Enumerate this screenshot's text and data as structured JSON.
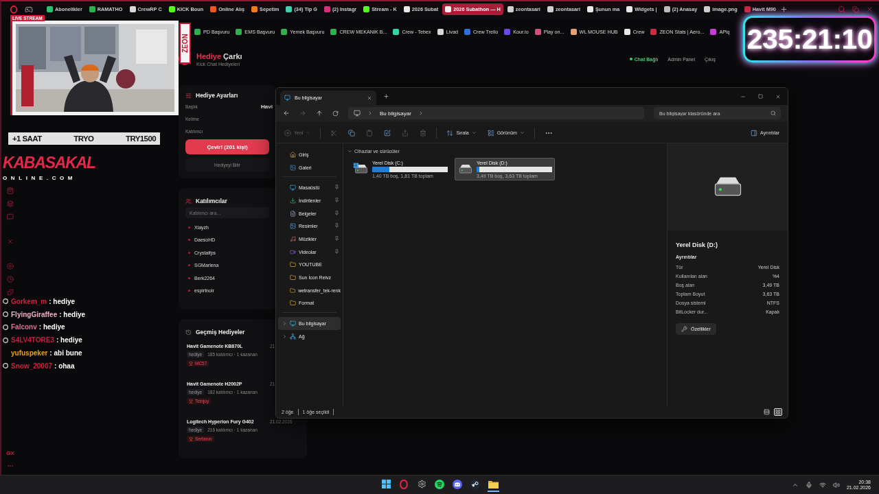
{
  "browser": {
    "tabs": [
      {
        "label": "Abonelikler",
        "color": "#2fbf71",
        "selected": false
      },
      {
        "label": "RAMATHO",
        "color": "#2fae4e",
        "selected": false
      },
      {
        "label": "CrewRP C",
        "color": "#d8d8d8",
        "selected": false
      },
      {
        "label": "KICK Boun",
        "color": "#53fc18",
        "selected": false
      },
      {
        "label": "Online Alış",
        "color": "#e8562a",
        "selected": false
      },
      {
        "label": "Sepetim",
        "color": "#f27a1a",
        "selected": false
      },
      {
        "label": "(34) Tip G",
        "color": "#3fd0b0",
        "selected": false
      },
      {
        "label": "(2) Instagr",
        "color": "#d6307a",
        "selected": false
      },
      {
        "label": "Stream - K",
        "color": "#53fc18",
        "selected": false
      },
      {
        "label": "2026 Subat",
        "color": "#e8e8e8",
        "selected": false
      },
      {
        "label": "2026 Subathon — H",
        "color": "#f0f0f0",
        "selected": true
      },
      {
        "label": "zeontasari",
        "color": "#cfcfcf",
        "selected": false
      },
      {
        "label": "zeontasari",
        "color": "#cfcfcf",
        "selected": false
      },
      {
        "label": "Şunun ma",
        "color": "#e8e8e8",
        "selected": false
      },
      {
        "label": "Widgets |",
        "color": "#e8e8e8",
        "selected": false
      },
      {
        "label": "(2) Anasay",
        "color": "#bdbdbd",
        "selected": false
      },
      {
        "label": "image.png",
        "color": "#cfcfcf",
        "selected": false
      },
      {
        "label": "Havit M90",
        "color": "#c8283c",
        "selected": false
      }
    ],
    "bookmarks": [
      {
        "label": "PD Başvuru",
        "color": "#2fae4e"
      },
      {
        "label": "EMS Başvuru",
        "color": "#2fae4e"
      },
      {
        "label": "Yemek Başvuru",
        "color": "#2fae4e"
      },
      {
        "label": "CREW MEKANİK B...",
        "color": "#2fae4e"
      },
      {
        "label": "Crew - Tebex",
        "color": "#3ad0a8"
      },
      {
        "label": "Livad",
        "color": "#d8d8d8"
      },
      {
        "label": "Crew Trello",
        "color": "#2f6fd6"
      },
      {
        "label": "Kour.io",
        "color": "#6a4ae0"
      },
      {
        "label": "Play on...",
        "color": "#d0507a"
      },
      {
        "label": "WL MOUSE HUB",
        "color": "#e8a070"
      },
      {
        "label": "Crew",
        "color": "#e8e8e8"
      },
      {
        "label": "ZEON Stats | Aero...",
        "color": "#d0283c"
      },
      {
        "label": "APiq",
        "color": "#c040d0"
      }
    ]
  },
  "sidebar": {
    "label": "GX"
  },
  "page": {
    "title_accent": "Hediye",
    "title": "Çarkı",
    "subtitle": "Kick Chat Hediyeleri",
    "nav": [
      {
        "label": "Chat Bağlı",
        "kind": "status"
      },
      {
        "label": "Admin Panel",
        "kind": "link"
      },
      {
        "label": "Çıkış",
        "kind": "link"
      }
    ],
    "settings": {
      "title": "Hediye Ayarları",
      "fields": [
        {
          "label": "Başlık",
          "value": "Havi"
        },
        {
          "label": "Kelime"
        },
        {
          "label": "Katılımcı"
        }
      ],
      "spin_button": "Çevir! (201 kişi)",
      "end_button": "Hediyeyi Bitir"
    },
    "participants": {
      "title": "Katılımcılar",
      "search": {
        "placeholder": "Katılımcı ara..."
      },
      "names": [
        "Xiayzh",
        "DaesoHD",
        "Crystalfps",
        "SGMarlena",
        "Berk2264",
        "espirtnoir"
      ]
    },
    "history": {
      "title": "Geçmiş Hediyeler",
      "items": [
        {
          "name": "Havit Gamenote KB870L",
          "tag": "hediye",
          "stats": "185 katılımcı · 1 kazanan",
          "winner": "MC57",
          "date": "21."
        },
        {
          "name": "Havit Gamenote H2002P",
          "tag": "hediye",
          "stats": "182 katılımcı · 1 kazanan",
          "winner": "Teinjoy",
          "date": "21."
        },
        {
          "name": "Logitech Hyperion Fury G402",
          "tag": "hediye",
          "stats": "216 katılımcı · 1 kazanan",
          "winner": "Sertanın",
          "date": "21.02.2026"
        }
      ]
    }
  },
  "explorer": {
    "tab_title": "Bu bilgisayar",
    "breadcrumb": "Bu bilgisayar",
    "search": {
      "placeholder": "Bu bilgisayar klasöründe ara"
    },
    "toolbar": [
      {
        "kind": "new",
        "label": "Yeni",
        "disabled": true
      },
      {
        "kind": "cut",
        "disabled": true
      },
      {
        "kind": "copy",
        "disabled": false
      },
      {
        "kind": "paste",
        "disabled": true
      },
      {
        "kind": "rename",
        "disabled": false
      },
      {
        "kind": "share",
        "disabled": true
      },
      {
        "kind": "delete",
        "disabled": true
      },
      {
        "kind": "sort",
        "label": "Sırala",
        "disabled": false
      },
      {
        "kind": "view",
        "label": "Görünüm",
        "disabled": false
      },
      {
        "kind": "more",
        "disabled": false
      }
    ],
    "details_toggle": "Ayrıntılar",
    "nav": [
      {
        "items": [
          {
            "label": "Giriş",
            "kind": "home"
          },
          {
            "label": "Galeri",
            "kind": "gallery"
          }
        ]
      },
      {
        "items": [
          {
            "label": "Masaüstü",
            "kind": "desktop",
            "pinned": true
          },
          {
            "label": "İndirilenler",
            "kind": "downloads",
            "pinned": true
          },
          {
            "label": "Belgeler",
            "kind": "documents",
            "pinned": true
          },
          {
            "label": "Resimler",
            "kind": "pictures",
            "pinned": true
          },
          {
            "label": "Müzikler",
            "kind": "music",
            "pinned": true
          },
          {
            "label": "Videolar",
            "kind": "videos",
            "pinned": true
          },
          {
            "label": "YOUTUBE",
            "kind": "folder",
            "pinned": false
          },
          {
            "label": "Sun İcon Reivz",
            "kind": "folder",
            "pinned": false
          },
          {
            "label": "wetransfer_tek-renk",
            "kind": "folder",
            "pinned": false
          },
          {
            "label": "Format",
            "kind": "folder",
            "pinned": false
          }
        ]
      },
      {
        "items": [
          {
            "label": "Bu bilgisayar",
            "kind": "pc",
            "selected": true
          },
          {
            "label": "Ağ",
            "kind": "network",
            "selected": false
          }
        ]
      }
    ],
    "section": {
      "title": "Cihazlar ve sürücüler",
      "expanded": true
    },
    "drives": [
      {
        "name": "Yerel Disk (C:)",
        "kind": "system",
        "level": 0.23,
        "info": "1,40 TB boş, 1,81 TB toplam",
        "selected": false
      },
      {
        "name": "Yerel Disk (D:)",
        "kind": "data",
        "level": 0.04,
        "info": "3,49 TB boş, 3,63 TB toplam",
        "selected": true
      }
    ],
    "details": {
      "title": "Yerel Disk (D:)",
      "heading": "Ayrıntılar",
      "rows": [
        {
          "label": "Tür",
          "value": "Yerel Disk"
        },
        {
          "label": "Kullanılan alan",
          "value": "%4"
        },
        {
          "label": "Boş alan",
          "value": "3,49 TB"
        },
        {
          "label": "Toplam Boyut",
          "value": "3,63 TB"
        },
        {
          "label": "Dosya sistemi",
          "value": "NTFS"
        },
        {
          "label": "BitLocker dur...",
          "value": "Kapalı"
        }
      ],
      "button": "Özellikler"
    },
    "status": {
      "count": "2 öğe",
      "selection": "1 öğe seçildi"
    },
    "views": [
      {
        "kind": "details",
        "selected": false
      },
      {
        "kind": "tiles",
        "selected": true
      }
    ]
  },
  "overlay": {
    "live_badge": "LIVE STREAM",
    "brand": "ZEON",
    "banner": [
      "+1 SAAT",
      "TRYO",
      "TRY1500"
    ],
    "logo_top": "KABASAKAL",
    "logo_bottom": "ONLINE.COM",
    "chat": [
      {
        "user": "Gorkem_m",
        "color": "#d4223f",
        "text": ": hediye",
        "badge": true
      },
      {
        "user": "FlyingGiraffee",
        "color": "#efb0c6",
        "text": ": hediye",
        "badge": true
      },
      {
        "user": "Falconv",
        "color": "#e07090",
        "text": ": hediye",
        "badge": true
      },
      {
        "user": "S4LV4TORE3",
        "color": "#cf1a3e",
        "text": ": hediye",
        "badge": true
      },
      {
        "user": "yufuspeker",
        "color": "#e8a020",
        "text": ": abi bune",
        "badge": false
      },
      {
        "user": "Snow_20007",
        "color": "#d0203a",
        "text": ": ohaa",
        "badge": true
      }
    ],
    "timer": "235:21:10"
  },
  "taskbar": {
    "time": "20:38",
    "date": "21.02.2026"
  }
}
